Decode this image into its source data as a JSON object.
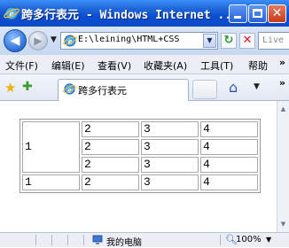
{
  "window": {
    "title": "跨多行表元 - Windows Internet ...",
    "close_glyph": "✕"
  },
  "addressbar": {
    "url": "E:\\leining\\HTML+CSS",
    "search_placeholder": "Live Search"
  },
  "menu": {
    "items": [
      "文件(F)",
      "编辑(E)",
      "查看(V)",
      "收藏夹(A)",
      "工具(T)",
      "帮助"
    ],
    "more": "»"
  },
  "tabs": {
    "active_label": "跨多行表元",
    "more": "»"
  },
  "table": {
    "rows": [
      [
        "1",
        "2",
        "3",
        "4"
      ],
      [
        "2",
        "3",
        "4"
      ],
      [
        "2",
        "3",
        "4"
      ],
      [
        "1",
        "2",
        "3",
        "4"
      ]
    ]
  },
  "status": {
    "zone": "我的电脑",
    "zoom": "100%"
  },
  "colors": {
    "titlebar": "#0a4fd0",
    "accent": "#2b58b0"
  }
}
